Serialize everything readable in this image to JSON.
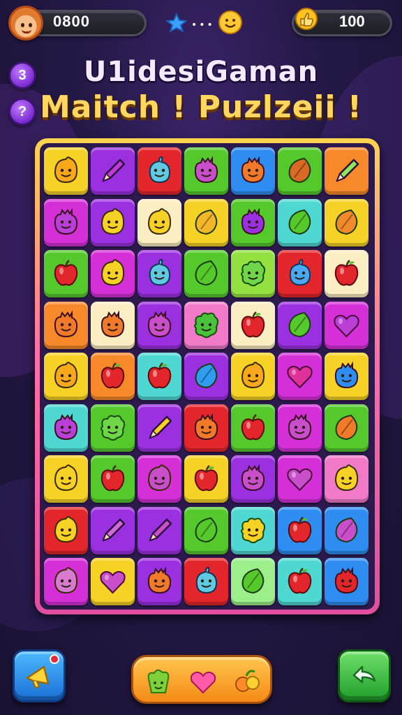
{
  "hud": {
    "score": "0800",
    "coins": "100",
    "progress_dots": "•••"
  },
  "side_buttons": {
    "first_label": "3",
    "second_label": "?"
  },
  "title": {
    "line1": "U1idesiGaman",
    "line2": "Maitch ! Puzlzeii !"
  },
  "colors": {
    "yellow": "#f6d126",
    "orange": "#f8892a",
    "red": "#e3262b",
    "green": "#55c92c",
    "lime": "#93e041",
    "blue": "#2f8cf0",
    "cyan": "#4fd8d2",
    "purple": "#9b30e0",
    "magenta": "#d530d8",
    "pink": "#f07ac8",
    "cream": "#fbeec2",
    "lightgreen": "#9cef8a"
  },
  "board": {
    "rows": 9,
    "cols": 7,
    "tiles": [
      [
        "yellow:smile:#f7a81b",
        "purple:pencil:#c23ad6",
        "red:blob:#5fc9e0",
        "green:fruit:#c94ec9",
        "blue:fruit:#f07a2a",
        "green:leaf:#d86a25",
        "orange:pencil:#8fe85a"
      ],
      [
        "magenta:fruit:#b93fd6",
        "purple:smile:#f6d126",
        "cream:smile:#f6d126",
        "yellow:leaf:#f3b62a",
        "green:fruit:#9b30e0",
        "cyan:leaf:#55c92c",
        "yellow:leaf:#f08a2a"
      ],
      [
        "green:apple:#e3262b",
        "magenta:smile:#f6d126",
        "purple:blob:#5fc9e0",
        "green:leaf:#55c92c",
        "lime:lettuce:#6fd64a",
        "red:blob:#4aa8f0",
        "cream:apple:#e3262b"
      ],
      [
        "orange:fruit:#f07a2a",
        "cream:fruit:#f07a2a",
        "purple:fruit:#c94ec9",
        "pink:lettuce:#47c23a",
        "cream:apple:#e3262b",
        "purple:leaf:#55c92c",
        "magenta:heart:#b93fd6"
      ],
      [
        "yellow:smile:#f7a81b",
        "orange:apple:#e3262b",
        "cyan:apple:#e3262b",
        "purple:leaf:#2f9cf0",
        "yellow:smile:#f7a81b",
        "magenta:heart:#e0309a",
        "yellow:fruit:#2f8cf0"
      ],
      [
        "cyan:fruit:#b93fd6",
        "green:lettuce:#6fd64a",
        "purple:pencil:#f6d126",
        "red:fruit:#f07a2a",
        "green:apple:#e3262b",
        "magenta:fruit:#c94ec9",
        "green:leaf:#f07a2a"
      ],
      [
        "yellow:smile:#f6d126",
        "green:apple:#e3262b",
        "magenta:smile:#c94ec9",
        "yellow:apple:#e3262b",
        "purple:fruit:#c94ec9",
        "magenta:heart:#c94ec9",
        "pink:smile:#f6d126"
      ],
      [
        "red:smile:#f6d126",
        "purple:pencil:#d36ad8",
        "purple:pencil:#c94ec9",
        "green:leaf:#55c92c",
        "cyan:lettuce:#f6d126",
        "blue:apple:#e3262b",
        "blue:leaf:#c94ec9"
      ],
      [
        "magenta:smile:#d77ad0",
        "yellow:heart:#c94ec9",
        "purple:fruit:#f07a2a",
        "red:blob:#5fc9e0",
        "lightgreen:leaf:#55c92c",
        "cyan:apple:#e3262b",
        "blue:fruit:#e3262b"
      ]
    ]
  },
  "bottom": {
    "left_icon": "megaphone-icon",
    "right_icon": "shuffle-arrow-icon",
    "boosters": [
      "lettuce-booster-icon",
      "heart-booster-icon",
      "fruit-bunch-booster-icon"
    ]
  }
}
